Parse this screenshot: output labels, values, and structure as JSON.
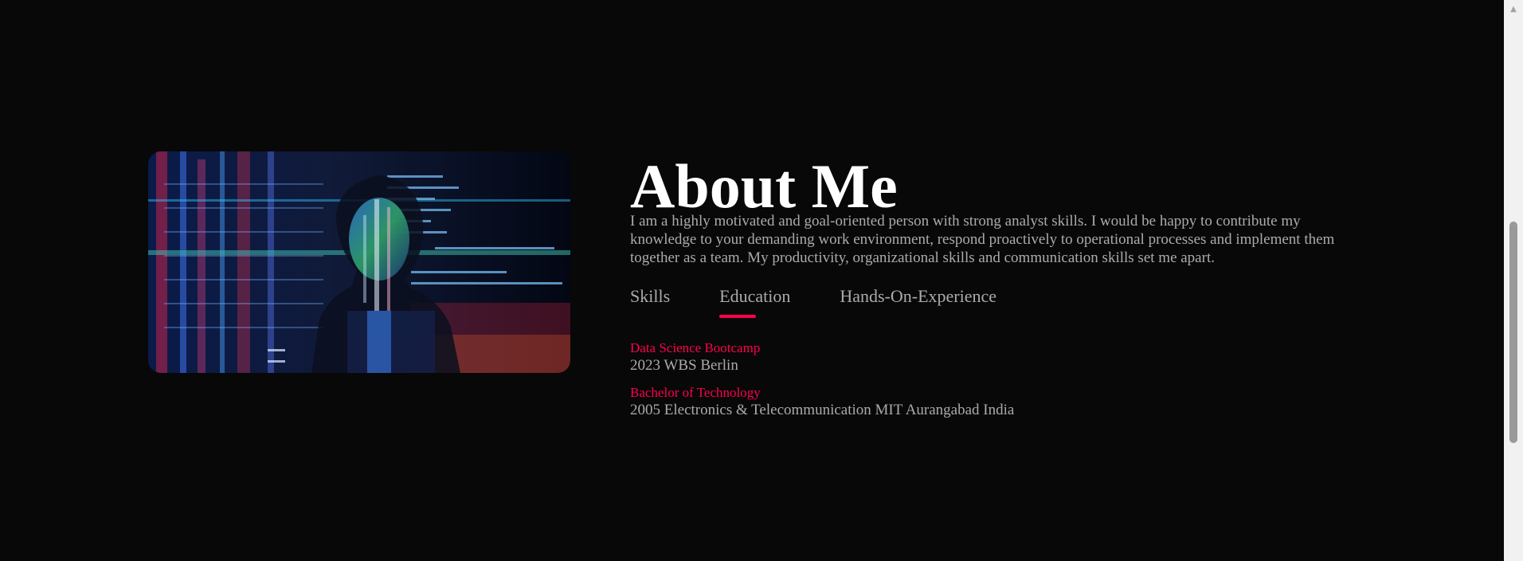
{
  "about": {
    "title": "About Me",
    "description": "I am a highly motivated and goal-oriented person with strong analyst skills. I would be happy to contribute my knowledge to your demanding work environment, respond proactively to operational processes and implement them together as a team. My productivity, organizational skills and communication skills set me apart."
  },
  "tabs": [
    {
      "label": "Skills",
      "active": false
    },
    {
      "label": "Education",
      "active": true
    },
    {
      "label": "Hands-On-Experience",
      "active": false
    }
  ],
  "education": [
    {
      "degree": "Data Science Bootcamp",
      "detail": "2023 WBS Berlin"
    },
    {
      "degree": "Bachelor of Technology",
      "detail": "2005 Electronics & Telecommunication MIT Aurangabad India"
    }
  ],
  "colors": {
    "background": "#080808",
    "accent": "#ff004f",
    "text": "#ababab",
    "title": "#ffffff"
  },
  "image": {
    "icon": "profile-photo-code-projection"
  },
  "scrollbar": {
    "up_icon": "▲"
  }
}
